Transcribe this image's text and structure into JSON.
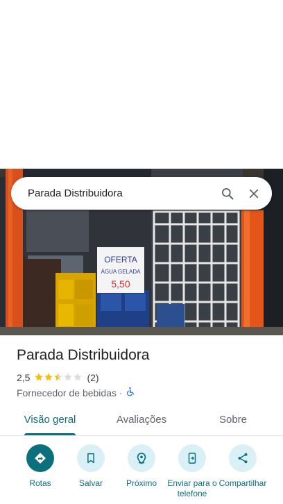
{
  "search": {
    "query": "Parada Distribuidora"
  },
  "photo": {
    "sign_lines": [
      "OFERTA",
      "ÁGUA GELADA",
      "5,50"
    ]
  },
  "place": {
    "title": "Parada Distribuidora",
    "rating": "2,5",
    "rating_value": 2.5,
    "review_count": "(2)",
    "category": "Fornecedor de bebidas",
    "separator": "·"
  },
  "tabs": [
    {
      "label": "Visão geral",
      "active": true
    },
    {
      "label": "Avaliações",
      "active": false
    },
    {
      "label": "Sobre",
      "active": false
    }
  ],
  "actions": [
    {
      "label": "Rotas",
      "icon": "directions-icon"
    },
    {
      "label": "Salvar",
      "icon": "bookmark-icon"
    },
    {
      "label": "Próximo",
      "icon": "nearby-icon"
    },
    {
      "label": "Enviar para o telefone",
      "icon": "send-to-phone-icon"
    },
    {
      "label": "Compartilhar",
      "icon": "share-icon"
    }
  ],
  "colors": {
    "accent": "#0b6f7c",
    "action_bg": "#d8f0f6",
    "star_filled": "#fbbc04",
    "star_empty": "#dadce0"
  }
}
